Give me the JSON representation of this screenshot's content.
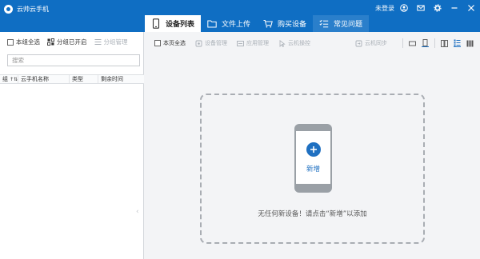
{
  "app": {
    "title": "云帅云手机",
    "login_status": "未登录",
    "accent_color": "#0f6ec3"
  },
  "tabs": [
    {
      "label": "设备列表",
      "icon": "phone-icon",
      "active": true
    },
    {
      "label": "文件上传",
      "icon": "folder-icon",
      "active": false
    },
    {
      "label": "购买设备",
      "icon": "cart-icon",
      "active": false
    },
    {
      "label": "常见问题",
      "icon": "faq-list-icon",
      "active": false
    }
  ],
  "left": {
    "select_all_label": "本组全选",
    "group_open_label": "分组已开启",
    "group_manage_label": "分组管理",
    "search_placeholder": "搜索",
    "columns": {
      "group": "组",
      "name": "云手机名称",
      "type": "类型",
      "expire": "剩余时间"
    }
  },
  "right": {
    "toolbar": {
      "page_select_all": "本页全选",
      "device_manage": "设备管理",
      "app_manage": "应用管理",
      "cloud_action": "云机操控",
      "cloud_sync": "云机同步"
    },
    "empty": {
      "add_label": "新增",
      "message": "无任何新设备！请点击“新增”以添加"
    }
  }
}
